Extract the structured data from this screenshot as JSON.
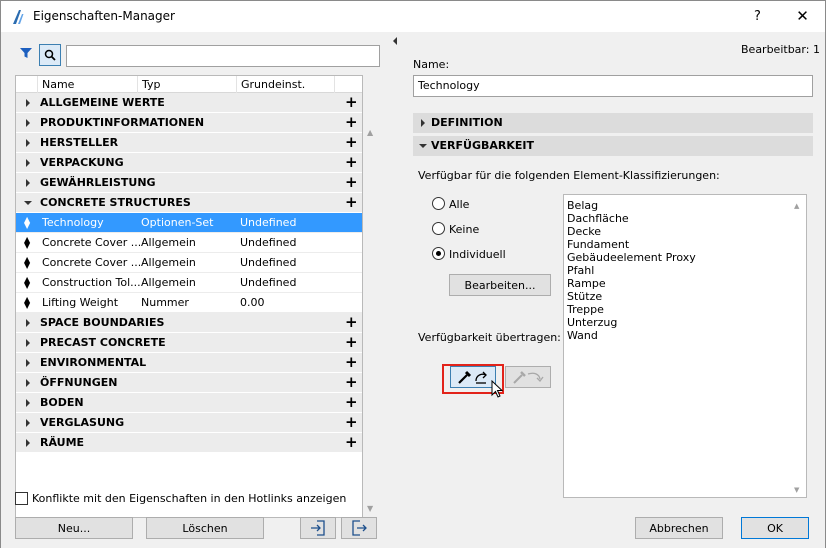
{
  "window": {
    "title": "Eigenschaften-Manager",
    "help_label": "?",
    "close_label": "✕"
  },
  "left": {
    "search": {
      "value": "",
      "placeholder": ""
    },
    "columns": [
      "",
      "Name",
      "Typ",
      "Grundeinst.",
      ""
    ],
    "rows": [
      {
        "kind": "group",
        "label": "ALLGEMEINE WERTE",
        "expanded": false
      },
      {
        "kind": "group",
        "label": "PRODUKTINFORMATIONEN",
        "expanded": false
      },
      {
        "kind": "group",
        "label": "HERSTELLER",
        "expanded": false
      },
      {
        "kind": "group",
        "label": "VERPACKUNG",
        "expanded": false
      },
      {
        "kind": "group",
        "label": "GEWÄHRLEISTUNG",
        "expanded": false
      },
      {
        "kind": "group",
        "label": "CONCRETE STRUCTURES",
        "expanded": true
      },
      {
        "kind": "prop",
        "name": "Technology",
        "type": "Optionen-Set",
        "default": "Undefined",
        "selected": true
      },
      {
        "kind": "prop",
        "name": "Concrete Cover ...",
        "type": "Allgemein",
        "default": "Undefined",
        "selected": false
      },
      {
        "kind": "prop",
        "name": "Concrete Cover ...",
        "type": "Allgemein",
        "default": "Undefined",
        "selected": false
      },
      {
        "kind": "prop",
        "name": "Construction Tol...",
        "type": "Allgemein",
        "default": "Undefined",
        "selected": false
      },
      {
        "kind": "prop",
        "name": "Lifting Weight",
        "type": "Nummer",
        "default": "0.00",
        "selected": false
      },
      {
        "kind": "group",
        "label": "SPACE BOUNDARIES",
        "expanded": false
      },
      {
        "kind": "group",
        "label": "PRECAST CONCRETE",
        "expanded": false
      },
      {
        "kind": "group",
        "label": "ENVIRONMENTAL",
        "expanded": false
      },
      {
        "kind": "group",
        "label": "ÖFFNUNGEN",
        "expanded": false
      },
      {
        "kind": "group",
        "label": "BODEN",
        "expanded": false
      },
      {
        "kind": "group",
        "label": "VERGLASUNG",
        "expanded": false
      },
      {
        "kind": "group",
        "label": "RÄUME",
        "expanded": false
      }
    ],
    "hotlinks_checkbox_label": "Konflikte mit den Eigenschaften in den Hotlinks anzeigen",
    "hotlinks_checked": false,
    "new_button": "Neu...",
    "delete_button": "Löschen"
  },
  "right": {
    "editable_label": "Bearbeitbar: 1",
    "name_label": "Name:",
    "name_value": "Technology",
    "definition_label": "DEFINITION",
    "availability_label": "VERFÜGBARKEIT",
    "available_for_label": "Verfügbar für die folgenden Element-Klassifizierungen:",
    "radio_all": "Alle",
    "radio_none": "Keine",
    "radio_custom": "Individuell",
    "selected_radio": "custom",
    "edit_button": "Bearbeiten...",
    "transfer_label": "Verfügbarkeit übertragen:",
    "classifications": [
      "Belag",
      "Dachfläche",
      "Decke",
      "Fundament",
      "Gebäudeelement Proxy",
      "Pfahl",
      "Rampe",
      "Stütze",
      "Treppe",
      "Unterzug",
      "Wand"
    ],
    "cancel_button": "Abbrechen",
    "ok_button": "OK"
  },
  "colors": {
    "selection": "#3399ff",
    "highlight": "#e2231a",
    "accent": "#0078d7"
  }
}
